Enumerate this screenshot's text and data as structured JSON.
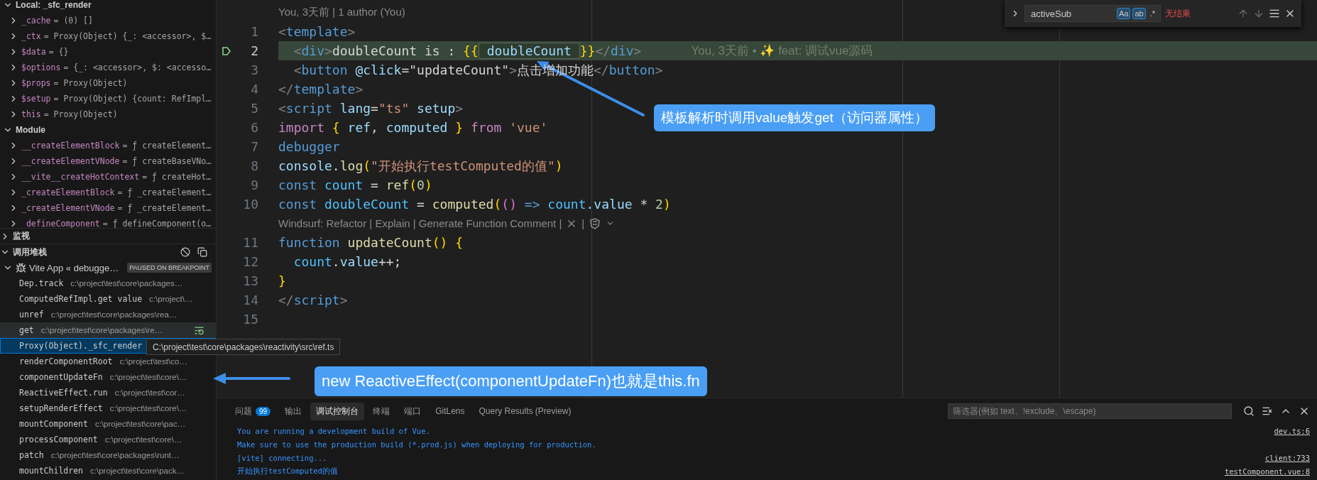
{
  "variables": {
    "scopes": [
      {
        "label": "Local: _sfc_render",
        "expanded": true,
        "items": [
          {
            "name": "_cache",
            "value": "= (0) []",
            "expanded": false
          },
          {
            "name": "_ctx",
            "value": "= Proxy(Object) {_: <accessor>, $…",
            "expanded": false
          },
          {
            "name": "$data",
            "value": "= {}",
            "expanded": false
          },
          {
            "name": "$options",
            "value": "= {_: <accessor>, $: <accesso…",
            "expanded": false
          },
          {
            "name": "$props",
            "value": "= Proxy(Object)",
            "expanded": false
          },
          {
            "name": "$setup",
            "value": "= Proxy(Object) {count: RefImpl…",
            "expanded": false
          },
          {
            "name": "this",
            "value": "= Proxy(Object)",
            "expanded": false
          }
        ]
      },
      {
        "label": "Module",
        "expanded": true,
        "items": [
          {
            "name": "__createElementBlock",
            "value": "= ƒ createElement…",
            "expanded": false
          },
          {
            "name": "__createElementVNode",
            "value": "= ƒ createBaseVNo…",
            "expanded": false
          },
          {
            "name": "__vite__createHotContext",
            "value": "= ƒ createHot…",
            "expanded": false
          },
          {
            "name": "_createElementBlock",
            "value": "= ƒ _createElement…",
            "expanded": false
          },
          {
            "name": "_createElementVNode",
            "value": "= ƒ _createElement…",
            "expanded": false
          },
          {
            "name": "_defineComponent",
            "value": "= ƒ defineComponent(o…",
            "expanded": false
          }
        ]
      }
    ]
  },
  "watch": {
    "label": "监视",
    "expanded": false
  },
  "call_stack": {
    "label": "调用堆栈",
    "expanded": true,
    "thread": {
      "label": "Vite App « debugge…",
      "status": "PAUSED ON BREAKPOINT",
      "expanded": true
    },
    "frames": [
      {
        "name": "Dep.track",
        "path": "c:\\project\\test\\core\\packages…",
        "selected": false,
        "hovered": false
      },
      {
        "name": "ComputedRefImpl.get value",
        "path": "c:\\project\\…",
        "selected": false,
        "hovered": false
      },
      {
        "name": "unref",
        "path": "c:\\project\\test\\core\\packages\\rea…",
        "selected": false,
        "hovered": false
      },
      {
        "name": "get",
        "path": "c:\\project\\test\\core\\packages\\re…",
        "selected": false,
        "hovered": true
      },
      {
        "name": "Proxy(Object)._sfc_render",
        "selected": true,
        "hovered": false
      },
      {
        "name": "renderComponentRoot",
        "path": "c:\\project\\test\\co…",
        "selected": false,
        "hovered": false
      },
      {
        "name": "componentUpdateFn",
        "path": "c:\\project\\test\\core\\…",
        "selected": false,
        "hovered": false
      },
      {
        "name": "ReactiveEffect.run",
        "path": "c:\\project\\test\\cor…",
        "selected": false,
        "hovered": false
      },
      {
        "name": "setupRenderEffect",
        "path": "c:\\project\\test\\core\\…",
        "selected": false,
        "hovered": false
      },
      {
        "name": "mountComponent",
        "path": "c:\\project\\test\\core\\pac…",
        "selected": false,
        "hovered": false
      },
      {
        "name": "processComponent",
        "path": "c:\\project\\test\\core\\…",
        "selected": false,
        "hovered": false
      },
      {
        "name": "patch",
        "path": "c:\\project\\test\\core\\packages\\runt…",
        "selected": false,
        "hovered": false
      },
      {
        "name": "mountChildren",
        "path": "c:\\project\\test\\core\\pack…",
        "selected": false,
        "hovered": false
      }
    ],
    "tooltip": "C:\\project\\test\\core\\packages\\reactivity\\src\\ref.ts"
  },
  "editor": {
    "lines": [
      {
        "kind": "lens",
        "text": "You, 3天前 | 1 author (You)"
      },
      {
        "kind": "code",
        "number": "1",
        "current": false,
        "tokens": [
          {
            "text": "<",
            "kind": "punct"
          },
          {
            "text": "template",
            "kind": "tag"
          },
          {
            "text": ">",
            "kind": "punct"
          }
        ]
      },
      {
        "kind": "code",
        "number": "2",
        "current": true,
        "blame": "You, 3天前 • ✨ feat: 调试vue源码",
        "tokens": [
          {
            "text": "  <",
            "kind": "punct"
          },
          {
            "text": "div",
            "kind": "tag"
          },
          {
            "text": ">",
            "kind": "punct"
          },
          {
            "text": "doubleCount is : ",
            "kind": "plain"
          },
          {
            "text": "{{",
            "kind": "bracket"
          },
          {
            "text": " doubleCount ",
            "kind": "match"
          },
          {
            "text": "}}",
            "kind": "bracket"
          },
          {
            "text": "</",
            "kind": "punct"
          },
          {
            "text": "div",
            "kind": "tag"
          },
          {
            "text": ">",
            "kind": "punct"
          }
        ]
      },
      {
        "kind": "code",
        "number": "3",
        "current": false,
        "tokens": [
          {
            "text": "  <",
            "kind": "punct"
          },
          {
            "text": "button",
            "kind": "tag"
          },
          {
            "text": " @click",
            "kind": "attr"
          },
          {
            "text": "=",
            "kind": "plain"
          },
          {
            "text": "\"updateCount\"",
            "kind": "plain"
          },
          {
            "text": ">",
            "kind": "punct"
          },
          {
            "text": "点击增加功能",
            "kind": "plain"
          },
          {
            "text": "</",
            "kind": "punct"
          },
          {
            "text": "button",
            "kind": "tag"
          },
          {
            "text": ">",
            "kind": "punct"
          }
        ]
      },
      {
        "kind": "code",
        "number": "4",
        "current": false,
        "tokens": [
          {
            "text": "</",
            "kind": "punct"
          },
          {
            "text": "template",
            "kind": "tag"
          },
          {
            "text": ">",
            "kind": "punct"
          }
        ]
      },
      {
        "kind": "code",
        "number": "5",
        "current": false,
        "tokens": [
          {
            "text": "<",
            "kind": "punct"
          },
          {
            "text": "script",
            "kind": "tag"
          },
          {
            "text": " lang",
            "kind": "attr"
          },
          {
            "text": "=",
            "kind": "plain"
          },
          {
            "text": "\"ts\"",
            "kind": "string"
          },
          {
            "text": " setup",
            "kind": "attr"
          },
          {
            "text": ">",
            "kind": "punct"
          }
        ]
      },
      {
        "kind": "code",
        "number": "6",
        "current": false,
        "tokens": [
          {
            "text": "import",
            "kind": "control"
          },
          {
            "text": " {",
            "kind": "bracket"
          },
          {
            "text": " ref",
            "kind": "variable"
          },
          {
            "text": ", ",
            "kind": "plain"
          },
          {
            "text": "computed ",
            "kind": "variable"
          },
          {
            "text": "}",
            "kind": "bracket"
          },
          {
            "text": " from ",
            "kind": "control"
          },
          {
            "text": "'vue'",
            "kind": "string"
          }
        ]
      },
      {
        "kind": "code",
        "number": "7",
        "current": false,
        "tokens": [
          {
            "text": "debugger",
            "kind": "keyword"
          }
        ]
      },
      {
        "kind": "code",
        "number": "8",
        "current": false,
        "tokens": [
          {
            "text": "console",
            "kind": "variable"
          },
          {
            "text": ".",
            "kind": "plain"
          },
          {
            "text": "log",
            "kind": "function"
          },
          {
            "text": "(",
            "kind": "bracket"
          },
          {
            "text": "\"开始执行testComputed的值\"",
            "kind": "string"
          },
          {
            "text": ")",
            "kind": "bracket"
          }
        ]
      },
      {
        "kind": "code",
        "number": "9",
        "current": false,
        "tokens": [
          {
            "text": "const",
            "kind": "keyword"
          },
          {
            "text": " count",
            "kind": "constant"
          },
          {
            "text": " = ",
            "kind": "plain"
          },
          {
            "text": "ref",
            "kind": "function"
          },
          {
            "text": "(",
            "kind": "bracket"
          },
          {
            "text": "0",
            "kind": "number"
          },
          {
            "text": ")",
            "kind": "bracket"
          }
        ]
      },
      {
        "kind": "code",
        "number": "10",
        "current": false,
        "tokens": [
          {
            "text": "const",
            "kind": "keyword"
          },
          {
            "text": " doubleCount",
            "kind": "constant"
          },
          {
            "text": " = ",
            "kind": "plain"
          },
          {
            "text": "computed",
            "kind": "function"
          },
          {
            "text": "(",
            "kind": "bracket"
          },
          {
            "text": "()",
            "kind": "bracket2"
          },
          {
            "text": " => ",
            "kind": "keyword"
          },
          {
            "text": "count",
            "kind": "constant"
          },
          {
            "text": ".value",
            "kind": "variable"
          },
          {
            "text": " * ",
            "kind": "plain"
          },
          {
            "text": "2",
            "kind": "number"
          },
          {
            "text": ")",
            "kind": "bracket"
          }
        ]
      },
      {
        "kind": "lens",
        "text": "Windsurf: Refactor | Explain | Generate Function Comment |",
        "tail": "|",
        "closable": true,
        "logo": true
      },
      {
        "kind": "code",
        "number": "11",
        "current": false,
        "tokens": [
          {
            "text": "function",
            "kind": "keyword"
          },
          {
            "text": " updateCount",
            "kind": "function"
          },
          {
            "text": "()",
            "kind": "bracket"
          },
          {
            "text": " {",
            "kind": "bracket"
          }
        ]
      },
      {
        "kind": "code",
        "number": "12",
        "current": false,
        "tokens": [
          {
            "text": "  count",
            "kind": "constant"
          },
          {
            "text": ".",
            "kind": "plain"
          },
          {
            "text": "value",
            "kind": "variable"
          },
          {
            "text": "++;",
            "kind": "plain"
          }
        ]
      },
      {
        "kind": "code",
        "number": "13",
        "current": false,
        "tokens": [
          {
            "text": "}",
            "kind": "bracket"
          }
        ]
      },
      {
        "kind": "code",
        "number": "14",
        "current": false,
        "tokens": [
          {
            "text": "</",
            "kind": "punct"
          },
          {
            "text": "script",
            "kind": "tag"
          },
          {
            "text": ">",
            "kind": "punct"
          }
        ]
      },
      {
        "kind": "code",
        "number": "15",
        "current": false
      }
    ]
  },
  "find": {
    "value": "activeSub",
    "toggles": [
      {
        "label": "Aa",
        "on": true
      },
      {
        "label": "ab",
        "on": true
      },
      {
        "label": ".*",
        "on": false
      }
    ],
    "result": "无结果"
  },
  "panel": {
    "tabs": [
      {
        "label": "问题",
        "badge": "99",
        "selected": false
      },
      {
        "label": "输出",
        "selected": false
      },
      {
        "label": "调试控制台",
        "selected": true
      },
      {
        "label": "终端",
        "selected": false
      },
      {
        "label": "端口",
        "selected": false
      },
      {
        "label": "GitLens",
        "selected": false
      },
      {
        "label": "Query Results (Preview)",
        "selected": false
      }
    ],
    "filter_placeholder": "筛选器(例如 text、!exclude、\\escape)",
    "console": [
      {
        "text": "You are running a development build of Vue.",
        "source": "dev.ts:6"
      },
      {
        "text": "Make sure to use the production build (*.prod.js) when deploying for production."
      },
      {
        "text": "[vite] connecting...",
        "source": "client:733"
      },
      {
        "text": "开始执行testComputed的值",
        "source": "testComponent.vue:8"
      }
    ]
  },
  "annotations": [
    {
      "text": "模板解析时调用value触发get（访问器属性）"
    },
    {
      "text": "new ReactiveEffect(componentUpdateFn)也就是this.fn"
    }
  ]
}
